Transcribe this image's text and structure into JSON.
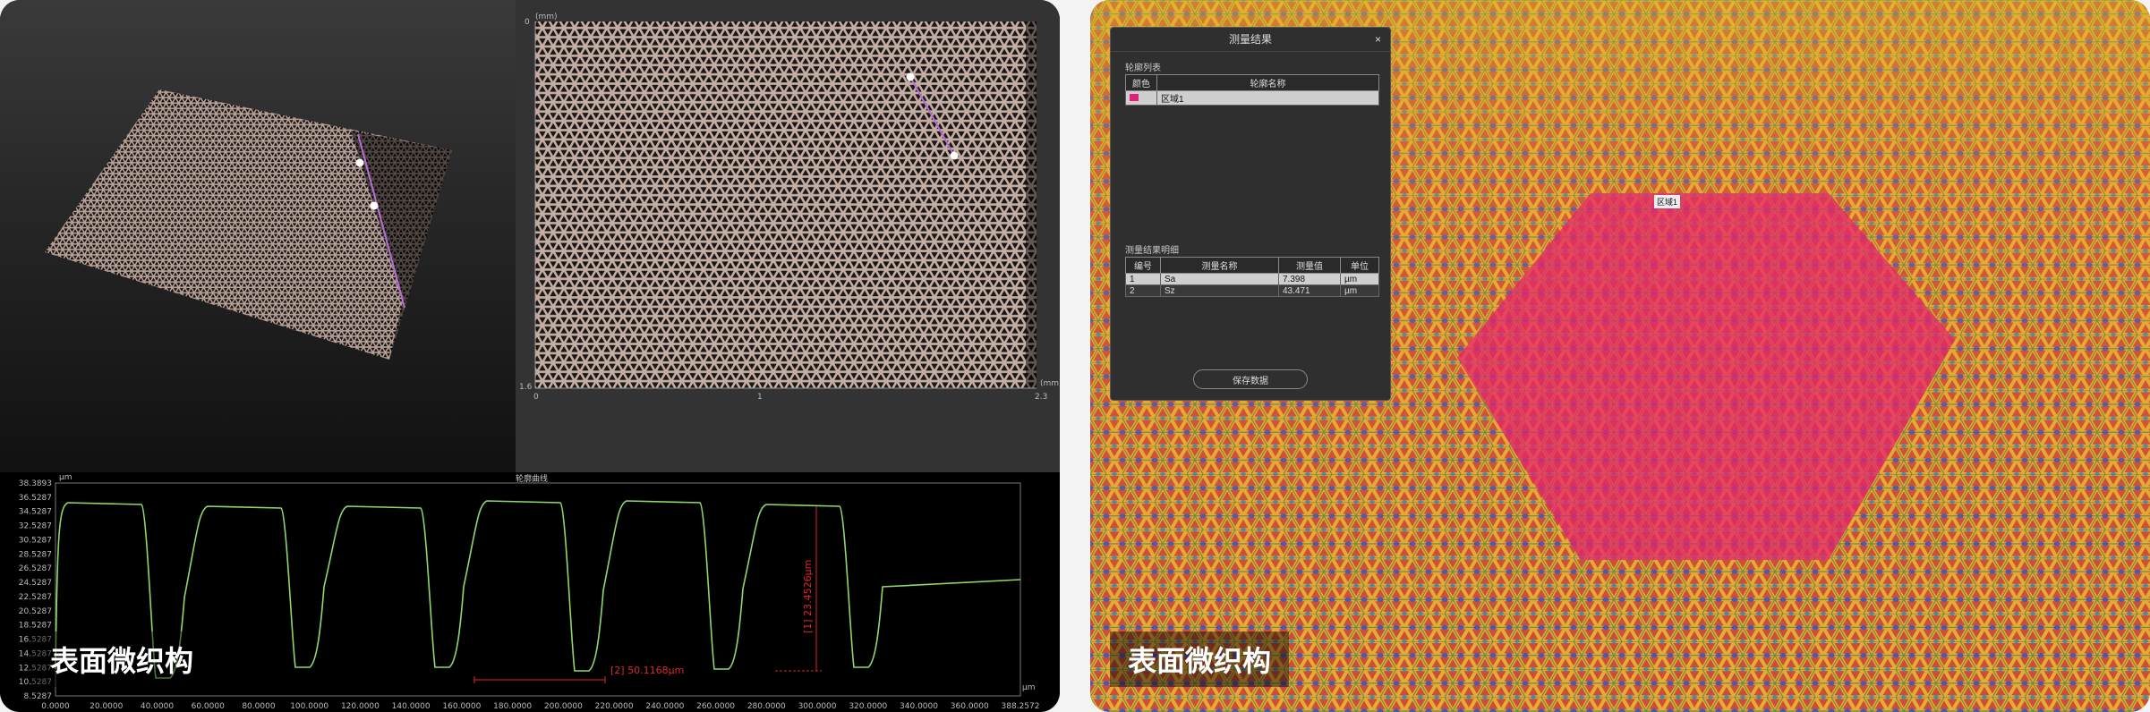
{
  "left_panel": {
    "view2d": {
      "unit_top": "(mm)",
      "unit_right": "(mm)",
      "y_top": "0",
      "y_bottom": "1.6",
      "x_ticks": [
        "0",
        "1",
        "2.3"
      ]
    },
    "profile": {
      "title": "轮廓曲线",
      "y_unit": "µm",
      "x_unit": "µm",
      "y_ticks": [
        "38.3893",
        "36.5287",
        "34.5287",
        "32.5287",
        "30.5287",
        "28.5287",
        "26.5287",
        "24.5287",
        "22.5287",
        "20.5287",
        "18.5287",
        "16.5287",
        "14.5287",
        "12.5287",
        "10.5287",
        "8.5287"
      ],
      "x_ticks": [
        "0.0000",
        "20.0000",
        "40.0000",
        "60.0000",
        "80.0000",
        "100.0000",
        "120.0000",
        "140.0000",
        "160.0000",
        "180.0000",
        "200.0000",
        "220.0000",
        "240.0000",
        "260.0000",
        "280.0000",
        "300.0000",
        "320.0000",
        "340.0000",
        "360.0000",
        "388.2572"
      ],
      "measure_height": "[1] 23.4526µm",
      "measure_width": "[2] 50.1168µm",
      "line_color": "#8fd86a",
      "measure_color": "#e0262b"
    },
    "caption": "表面微织构"
  },
  "right_panel": {
    "dialog": {
      "title": "测量结果",
      "close_label": "×",
      "contour_section": "轮廓列表",
      "contour_headers": [
        "颜色",
        "轮廓名称"
      ],
      "contours": [
        {
          "name": "区域1",
          "color": "#e0207a"
        }
      ],
      "results_section": "测量结果明细",
      "result_headers": [
        "编号",
        "测量名称",
        "测量值",
        "单位"
      ],
      "results": [
        {
          "id": "1",
          "name": "Sa",
          "value": "7.398",
          "unit": "µm"
        },
        {
          "id": "2",
          "name": "Sz",
          "value": "43.471",
          "unit": "µm"
        }
      ],
      "save_label": "保存数据"
    },
    "region_label": "区域1",
    "caption": "表面微织构"
  }
}
